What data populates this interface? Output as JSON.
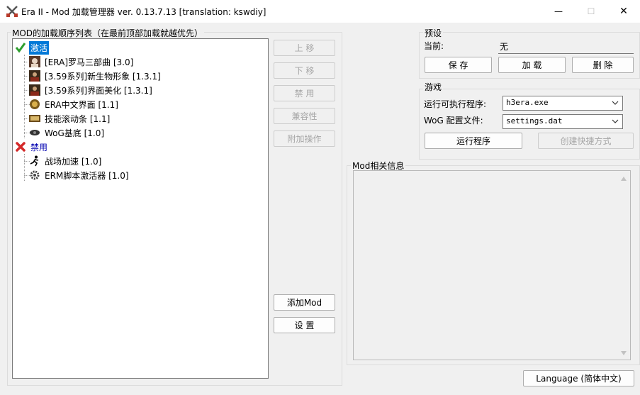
{
  "window": {
    "title": "Era II - Mod 加载管理器 ver. 0.13.7.13 [translation: kswdiy]",
    "minimize_glyph": "—",
    "maximize_glyph": "☐",
    "close_glyph": "✕"
  },
  "mod_list": {
    "group_title": "MOD的加载顺序列表（在最前顶部加载就越优先）",
    "categories": [
      {
        "label": "激活",
        "icon": "check-icon",
        "items": [
          {
            "label": "[ERA]罗马三部曲 [3.0]",
            "icon": "portrait-icon"
          },
          {
            "label": "[3.59系列]新生物形象 [1.3.1]",
            "icon": "creature-portrait-icon"
          },
          {
            "label": "[3.59系列]界面美化 [1.3.1]",
            "icon": "creature-portrait-icon"
          },
          {
            "label": "ERA中文界面 [1.1]",
            "icon": "emblem-icon"
          },
          {
            "label": "技能滚动条 [1.1]",
            "icon": "scroll-bar-icon"
          },
          {
            "label": "WoG基底 [1.0]",
            "icon": "eye-icon"
          }
        ]
      },
      {
        "label": "禁用",
        "icon": "x-mark-icon",
        "items": [
          {
            "label": "战场加速 [1.0]",
            "icon": "runner-icon"
          },
          {
            "label": "ERM脚本激活器 [1.0]",
            "icon": "gear-icon"
          }
        ]
      }
    ]
  },
  "mod_buttons": {
    "move_up": "上 移",
    "move_down": "下 移",
    "disable": "禁 用",
    "compatibility": "兼容性",
    "extra_actions": "附加操作",
    "add_mod": "添加Mod",
    "settings": "设 置"
  },
  "preset": {
    "group_title": "预设",
    "current_label": "当前:",
    "current_value": "无",
    "save": "保 存",
    "load": "加 载",
    "delete": "删 除"
  },
  "game": {
    "group_title": "游戏",
    "exe_label": "运行可执行程序:",
    "exe_value": "h3era.exe",
    "config_label": "WoG 配置文件:",
    "config_value": "settings.dat",
    "run": "运行程序",
    "create_shortcut": "创建快捷方式"
  },
  "mod_info": {
    "group_title": "Mod相关信息"
  },
  "language_button": "Language (简体中文)",
  "colors": {
    "selection": "#0078d7",
    "check_green": "#2e9e2e",
    "x_red": "#d42a2a",
    "disabled_text": "#a6a6a6"
  }
}
